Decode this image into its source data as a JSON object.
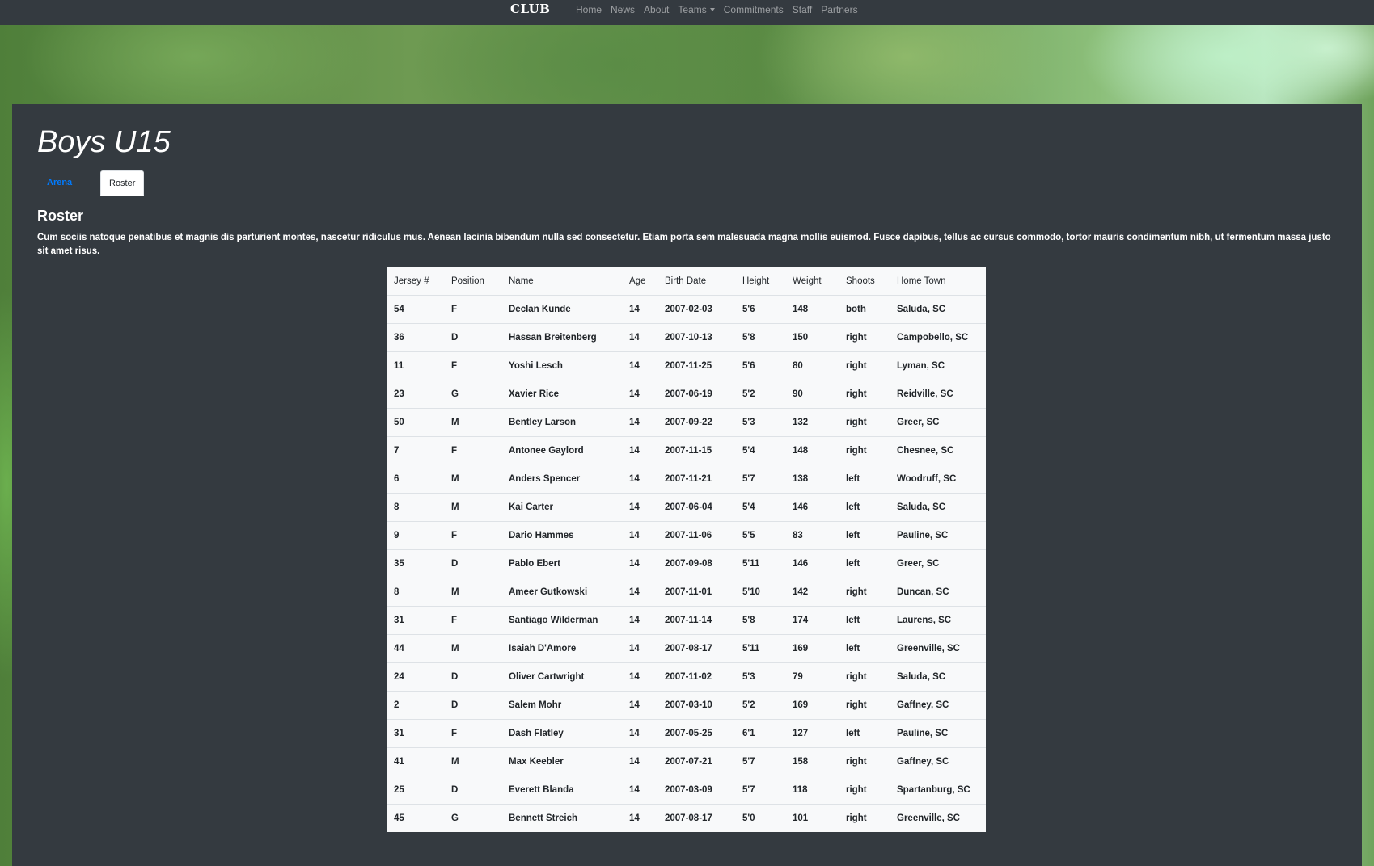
{
  "navbar": {
    "brand": "CLUB",
    "links": [
      "Home",
      "News",
      "About",
      "Teams",
      "Commitments",
      "Staff",
      "Partners"
    ]
  },
  "page": {
    "title": "Boys U15",
    "tabs": [
      "Arena",
      "Roster"
    ],
    "active_tab": "Roster",
    "section_title": "Roster",
    "lead": "Cum sociis natoque penatibus et magnis dis parturient montes, nascetur ridiculus mus. Aenean lacinia bibendum nulla sed consectetur. Etiam porta sem malesuada magna mollis euismod. Fusce dapibus, tellus ac cursus commodo, tortor mauris condimentum nibh, ut fermentum massa justo sit amet risus."
  },
  "roster": {
    "columns": [
      "Jersey #",
      "Position",
      "Name",
      "Age",
      "Birth Date",
      "Height",
      "Weight",
      "Shoots",
      "Home Town"
    ],
    "rows": [
      [
        "54",
        "F",
        "Declan Kunde",
        "14",
        "2007-02-03",
        "5'6",
        "148",
        "both",
        "Saluda, SC"
      ],
      [
        "36",
        "D",
        "Hassan Breitenberg",
        "14",
        "2007-10-13",
        "5'8",
        "150",
        "right",
        "Campobello, SC"
      ],
      [
        "11",
        "F",
        "Yoshi Lesch",
        "14",
        "2007-11-25",
        "5'6",
        "80",
        "right",
        "Lyman, SC"
      ],
      [
        "23",
        "G",
        "Xavier Rice",
        "14",
        "2007-06-19",
        "5'2",
        "90",
        "right",
        "Reidville, SC"
      ],
      [
        "50",
        "M",
        "Bentley Larson",
        "14",
        "2007-09-22",
        "5'3",
        "132",
        "right",
        "Greer, SC"
      ],
      [
        "7",
        "F",
        "Antonee Gaylord",
        "14",
        "2007-11-15",
        "5'4",
        "148",
        "right",
        "Chesnee, SC"
      ],
      [
        "6",
        "M",
        "Anders Spencer",
        "14",
        "2007-11-21",
        "5'7",
        "138",
        "left",
        "Woodruff, SC"
      ],
      [
        "8",
        "M",
        "Kai Carter",
        "14",
        "2007-06-04",
        "5'4",
        "146",
        "left",
        "Saluda, SC"
      ],
      [
        "9",
        "F",
        "Dario Hammes",
        "14",
        "2007-11-06",
        "5'5",
        "83",
        "left",
        "Pauline, SC"
      ],
      [
        "35",
        "D",
        "Pablo Ebert",
        "14",
        "2007-09-08",
        "5'11",
        "146",
        "left",
        "Greer, SC"
      ],
      [
        "8",
        "M",
        "Ameer Gutkowski",
        "14",
        "2007-11-01",
        "5'10",
        "142",
        "right",
        "Duncan, SC"
      ],
      [
        "31",
        "F",
        "Santiago Wilderman",
        "14",
        "2007-11-14",
        "5'8",
        "174",
        "left",
        "Laurens, SC"
      ],
      [
        "44",
        "M",
        "Isaiah D'Amore",
        "14",
        "2007-08-17",
        "5'11",
        "169",
        "left",
        "Greenville, SC"
      ],
      [
        "24",
        "D",
        "Oliver Cartwright",
        "14",
        "2007-11-02",
        "5'3",
        "79",
        "right",
        "Saluda, SC"
      ],
      [
        "2",
        "D",
        "Salem Mohr",
        "14",
        "2007-03-10",
        "5'2",
        "169",
        "right",
        "Gaffney, SC"
      ],
      [
        "31",
        "F",
        "Dash Flatley",
        "14",
        "2007-05-25",
        "6'1",
        "127",
        "left",
        "Pauline, SC"
      ],
      [
        "41",
        "M",
        "Max Keebler",
        "14",
        "2007-07-21",
        "5'7",
        "158",
        "right",
        "Gaffney, SC"
      ],
      [
        "25",
        "D",
        "Everett Blanda",
        "14",
        "2007-03-09",
        "5'7",
        "118",
        "right",
        "Spartanburg, SC"
      ],
      [
        "45",
        "G",
        "Bennett Streich",
        "14",
        "2007-08-17",
        "5'0",
        "101",
        "right",
        "Greenville, SC"
      ]
    ]
  }
}
